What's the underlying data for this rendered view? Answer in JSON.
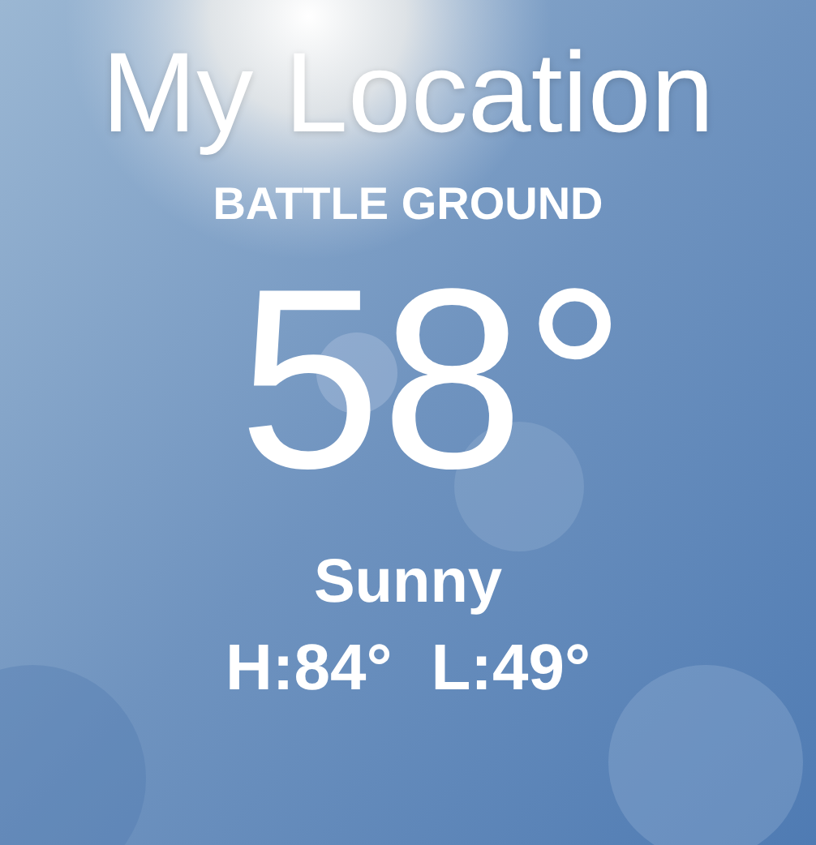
{
  "location_title": "My Location",
  "city": "BATTLE GROUND",
  "temperature": "58°",
  "condition": "Sunny",
  "high": "H:84°",
  "low": "L:49°"
}
